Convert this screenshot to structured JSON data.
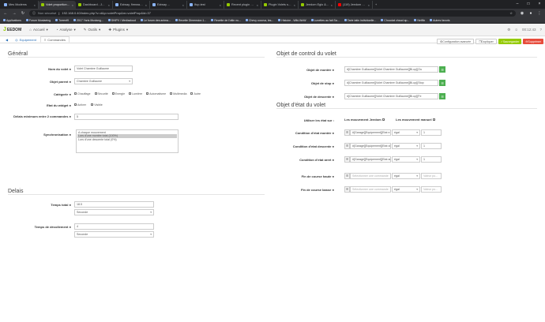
{
  "browser": {
    "tabs": [
      {
        "title": "Mes Modems",
        "active": false
      },
      {
        "title": "Volet proportionnel - Jeedom",
        "active": true
      },
      {
        "title": "Dashboard - Jeedom",
        "active": false
      },
      {
        "title": "Eziway, firmware polyvol...",
        "active": false
      },
      {
        "title": "Eziway ...",
        "active": false
      },
      {
        "title": "Ifup-test",
        "active": false
      },
      {
        "title": "Recent plugin volet proportio...",
        "active": false
      },
      {
        "title": "Plugin Volets stackaction",
        "active": false
      },
      {
        "title": "Jeedom Eglo & BJRA - Foru...",
        "active": false
      },
      {
        "title": "(119) Jeedom Smart ADAPT...",
        "active": false
      }
    ],
    "insecure": "Non sécurisé",
    "url": "192.168.0.40/index.php?v=d&p=voletProp&m=voletProp&id=37",
    "bookmarks": [
      "Applications",
      "Forum Mustaeing",
      "Torrent9",
      "2017 Yaris Mustang...",
      "SHIPV / Mediacloud",
      "Le forum des anima...",
      "Recette Dimension 1...",
      "Recette de l'ottin nu...",
      "Chevy cocova, les...",
      "Histoire - Wiki-WoW",
      "Lunettes au fait Sa...",
      "Tarte tatin individuelle...",
      "Chocolat chaud ap...",
      "Netflix",
      "Autres favoris"
    ]
  },
  "nav": {
    "brand": "EEDOM",
    "items": [
      "Accueil",
      "Analyse",
      "Outils",
      "Plugins"
    ],
    "time": "00:12:43"
  },
  "tabs": {
    "equipement": "Equipement",
    "commandes": "Commandes"
  },
  "actions": {
    "config": "Configuration avancée",
    "duplicate": "Dupliquer",
    "save": "Sauvegarder",
    "delete": "Supprimer"
  },
  "general": {
    "title": "Général",
    "name_label": "Nom du volet",
    "name_value": "Volet Chambre Guillaume",
    "parent_label": "Objet parent",
    "parent_value": "Chambre Guillaume",
    "category_label": "Catégorie",
    "categories": [
      {
        "label": "Chauffage",
        "checked": false
      },
      {
        "label": "Sécurité",
        "checked": false
      },
      {
        "label": "Energie",
        "checked": false
      },
      {
        "label": "Lumière",
        "checked": false
      },
      {
        "label": "Automatisme",
        "checked": true
      },
      {
        "label": "Multimedia",
        "checked": false
      },
      {
        "label": "Autre",
        "checked": false
      }
    ],
    "state_label": "Etat du widget",
    "activate": "Activer",
    "visible": "Visible",
    "delay_label": "Délais minimum entre 2 commandes",
    "delay_value": "5",
    "sync_label": "Synchronisation",
    "sync_options": [
      "A chaque mouvement",
      "Lors d'une montée total (100%)",
      "Lors d'une descente total (0%)"
    ],
    "sync_selected": 1
  },
  "delais": {
    "title": "Delais",
    "total_label": "Temps total",
    "total_value": "18.5",
    "total_unit": "Seconde",
    "decol_label": "Temps de décollement",
    "decol_value": "4",
    "decol_unit": "Seconde"
  },
  "control": {
    "title": "Objet de control du volet",
    "rows": [
      {
        "label": "Objet de montée",
        "value": "#[Chambre Guillaume][Volet Chambre Guillaume][Bi-up][Ou"
      },
      {
        "label": "Objet de stop",
        "value": "#[Chambre Guillaume][Volet Chambre Guillaume][Bi-up][Stop"
      },
      {
        "label": "Objet de descente",
        "value": "#[Chambre Guillaume][Volet Chambre Guillaume][Bi-up][Fe"
      }
    ]
  },
  "state": {
    "title": "Objet d'état du volet",
    "use_label": "Utiliser les état sur :",
    "jeedom": "Les mouvement Jeedom",
    "manuel": "Les mouvement manuel",
    "rows": [
      {
        "label": "Condition d'etat montée",
        "cmd": "#[Garage][Equipement][Etat e...",
        "op": "égal",
        "val": "1"
      },
      {
        "label": "Condition d'etat descente",
        "cmd": "#[Garage][Equipement][Etat de...",
        "op": "égal",
        "val": "1"
      },
      {
        "label": "Condition d'etat arret",
        "cmd": "#[Garage][Equipement][Etat ar...",
        "op": "égal",
        "val": "1"
      }
    ],
    "fin_rows": [
      {
        "label": "Fin de course haute",
        "cmd_ph": "Sélectionner une commande",
        "op": "égal",
        "val_ph": "Valeur po..."
      },
      {
        "label": "Fin de course basse",
        "cmd_ph": "Sélectionner une commande",
        "op": "égal",
        "val_ph": "Valeur po..."
      }
    ]
  }
}
